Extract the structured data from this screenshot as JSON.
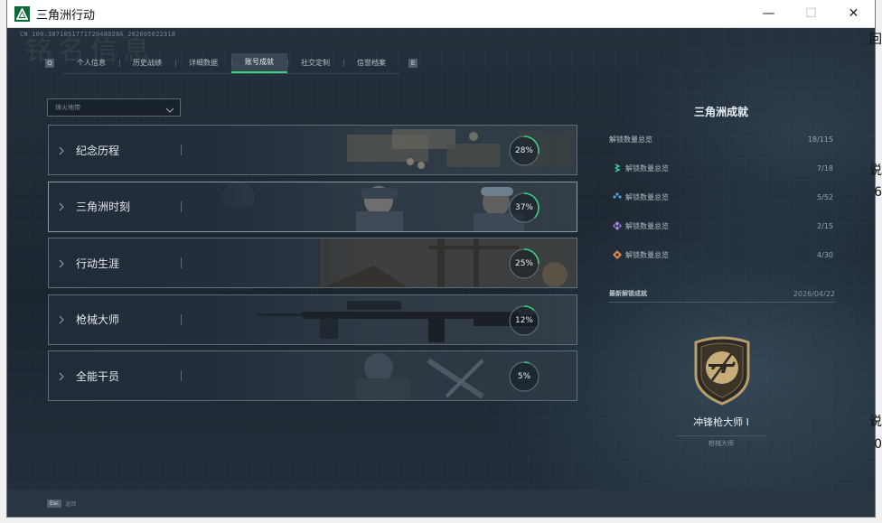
{
  "window": {
    "title": "三角洲行动",
    "minimize_glyph": "—",
    "maximize_glyph": "☐",
    "close_glyph": "✕"
  },
  "session_id": "CN 100:387105177172048028A_202605022318",
  "watermark": "铭名信息",
  "tabs": [
    {
      "label": "个人信息",
      "active": false
    },
    {
      "label": "历史战绩",
      "active": false
    },
    {
      "label": "详细数据",
      "active": false
    },
    {
      "label": "账号成就",
      "active": true
    },
    {
      "label": "社交定制",
      "active": false
    },
    {
      "label": "信誉档案",
      "active": false
    }
  ],
  "tab_nav": {
    "left": "Q",
    "right": "E"
  },
  "filter": {
    "value": "烽火地带"
  },
  "categories": [
    {
      "label": "纪念历程",
      "percent": 28,
      "art": "crates"
    },
    {
      "label": "三角洲时刻",
      "percent": 37,
      "art": "soldiers"
    },
    {
      "label": "行动生涯",
      "percent": 25,
      "art": "ruins"
    },
    {
      "label": "枪械大师",
      "percent": 12,
      "art": "rifle"
    },
    {
      "label": "全能干员",
      "percent": 5,
      "art": "operator"
    }
  ],
  "ring_color": "#36d482",
  "summary": {
    "title": "三角洲成就",
    "total": {
      "label": "解锁数量总览",
      "value": "18/115"
    },
    "rows": [
      {
        "label": "解锁数量总览",
        "value": "7/18",
        "icon": "teal-chevron-icon",
        "color": "#2fc7a2"
      },
      {
        "label": "解锁数量总览",
        "value": "5/52",
        "icon": "blue-diamond-cluster-icon",
        "color": "#4ea3e6"
      },
      {
        "label": "解锁数量总览",
        "value": "2/15",
        "icon": "purple-diamond-cluster-icon",
        "color": "#a67be8"
      },
      {
        "label": "解锁数量总览",
        "value": "4/30",
        "icon": "orange-diamond-icon",
        "color": "#e2874a"
      }
    ]
  },
  "latest": {
    "label": "最新解锁成就",
    "date": "2026/04/22",
    "badge_name": "冲锋枪大师 I",
    "badge_category": "枪械大师"
  },
  "footer": {
    "key": "Esc",
    "label": "返回"
  },
  "peek_text": [
    "回",
    "说",
    "6",
    "说",
    "0"
  ]
}
